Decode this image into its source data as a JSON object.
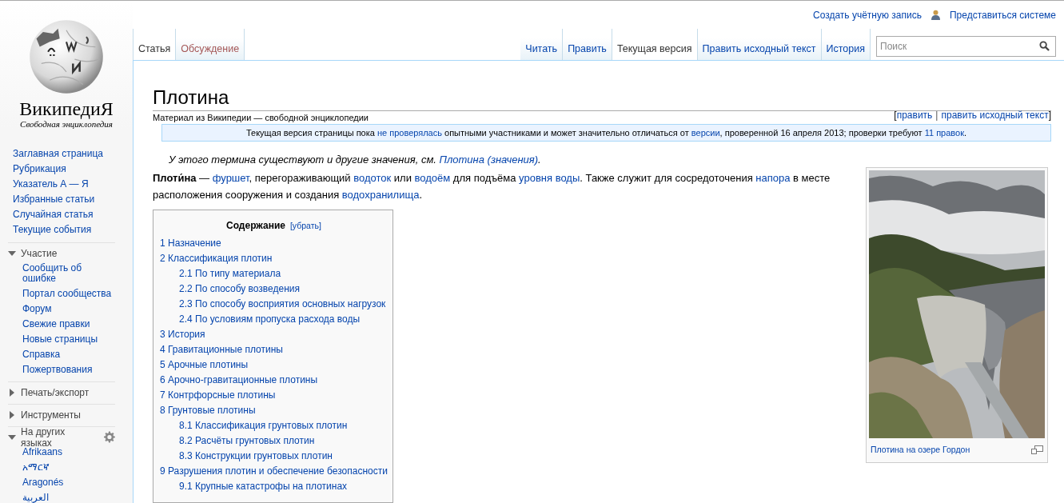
{
  "logo": {
    "wordmark": "ВикипедиЯ",
    "tagline": "Свободная энциклопедия"
  },
  "personal": {
    "create_account": "Создать учётную запись",
    "login": "Представиться системе"
  },
  "left_tabs": [
    {
      "label": "Статья",
      "selected": true,
      "redlink": false
    },
    {
      "label": "Обсуждение",
      "selected": false,
      "redlink": true
    }
  ],
  "right_tabs": [
    {
      "label": "Читать",
      "selected": false
    },
    {
      "label": "Править",
      "selected": false
    },
    {
      "label": "Текущая версия",
      "selected": true
    },
    {
      "label": "Править исходный текст",
      "selected": false
    },
    {
      "label": "История",
      "selected": false
    }
  ],
  "search": {
    "placeholder": "Поиск"
  },
  "sidebar": {
    "items": [
      "Заглавная страница",
      "Рубрикация",
      "Указатель А — Я",
      "Избранные статьи",
      "Случайная статья",
      "Текущие события"
    ],
    "portals": [
      {
        "title": "Участие",
        "expanded": true,
        "items": [
          "Сообщить об ошибке",
          "Портал сообщества",
          "Форум",
          "Свежие правки",
          "Новые страницы",
          "Справка",
          "Пожертвования"
        ]
      },
      {
        "title": "Печать/экспорт",
        "expanded": false
      },
      {
        "title": "Инструменты",
        "expanded": false
      },
      {
        "title": "На других языках",
        "expanded": true,
        "gear": true,
        "items": [
          "Afrikaans",
          "አማርኛ",
          "Aragonés",
          "العربية"
        ]
      }
    ]
  },
  "article": {
    "title": "Плотина",
    "subtitle": "Материал из Википедии — свободной энциклопедии",
    "edit_links": {
      "open": "[",
      "separator": "|",
      "close": "]",
      "items": [
        "править",
        "править исходный текст"
      ]
    },
    "notice": [
      {
        "kind": "text",
        "text": "Текущая версия страницы пока "
      },
      {
        "kind": "link",
        "text": "не проверялась"
      },
      {
        "kind": "text",
        "text": " опытными участниками и может значительно отличаться от "
      },
      {
        "kind": "link",
        "text": "версии"
      },
      {
        "kind": "text",
        "text": ", проверенной 16 апреля 2013; проверки требуют "
      },
      {
        "kind": "link",
        "text": "11 правок"
      },
      {
        "kind": "text",
        "text": "."
      }
    ],
    "hatnote": [
      {
        "kind": "text",
        "text": "У этого термина существуют и другие значения, см. "
      },
      {
        "kind": "link",
        "text": "Плотина (значения)"
      },
      {
        "kind": "text",
        "text": "."
      }
    ],
    "lead": [
      {
        "kind": "bold",
        "text": "Плоти́на"
      },
      {
        "kind": "text",
        "text": " — "
      },
      {
        "kind": "link",
        "text": "фуршет"
      },
      {
        "kind": "text",
        "text": ", перегораживающий "
      },
      {
        "kind": "link",
        "text": "водоток"
      },
      {
        "kind": "text",
        "text": " или "
      },
      {
        "kind": "link",
        "text": "водоём"
      },
      {
        "kind": "text",
        "text": " для подъёма "
      },
      {
        "kind": "link",
        "text": "уровня воды"
      },
      {
        "kind": "text",
        "text": ". Также служит для сосредоточения "
      },
      {
        "kind": "link",
        "text": "напора"
      },
      {
        "kind": "text",
        "text": " в месте расположения сооружения и создания "
      },
      {
        "kind": "link",
        "text": "водохранилища"
      },
      {
        "kind": "text",
        "text": "."
      }
    ],
    "thumb": {
      "kind": "picture",
      "caption": "Плотина на озере Гордон"
    },
    "toc": {
      "title": "Содержание",
      "toggle": "[убрать]",
      "items": [
        {
          "label": "1 Назначение"
        },
        {
          "label": "2 Классификация плотин",
          "children": [
            {
              "label": "2.1 По типу материала"
            },
            {
              "label": "2.2 По способу возведения"
            },
            {
              "label": "2.3 По способу восприятия основных нагрузок"
            },
            {
              "label": "2.4 По условиям пропуска расхода воды"
            }
          ]
        },
        {
          "label": "3 История"
        },
        {
          "label": "4 Гравитационные плотины"
        },
        {
          "label": "5 Арочные плотины"
        },
        {
          "label": "6 Арочно-гравитационные плотины"
        },
        {
          "label": "7 Контрфорсные плотины"
        },
        {
          "label": "8 Грунтовые плотины",
          "children": [
            {
              "label": "8.1 Классификация грунтовых плотин"
            },
            {
              "label": "8.2 Расчёты грунтовых плотин"
            },
            {
              "label": "8.3 Конструкции грунтовых плотин"
            }
          ]
        },
        {
          "label": "9 Разрушения плотин и обеспечение безопасности",
          "children": [
            {
              "label": "9.1 Крупные катастрофы на плотинах"
            }
          ]
        }
      ]
    }
  }
}
